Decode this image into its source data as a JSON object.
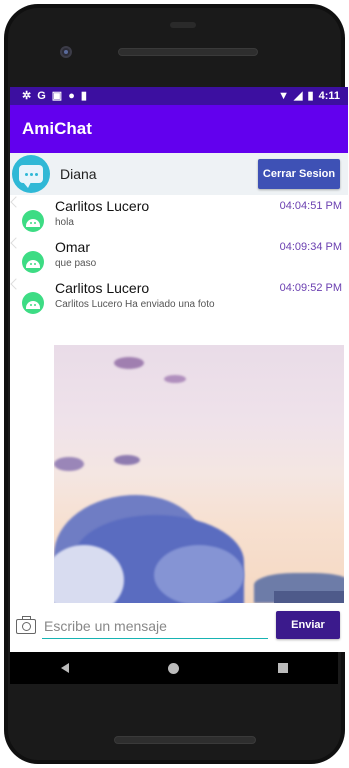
{
  "status_bar": {
    "left_icons": [
      "gear-icon",
      "google-icon",
      "gallery-icon",
      "dot-icon",
      "sd-card-icon"
    ],
    "time": "4:11"
  },
  "app_bar": {
    "title": "AmiChat"
  },
  "user_bar": {
    "name": "Diana",
    "logout_label": "Cerrar Sesion"
  },
  "messages": [
    {
      "sender": "Carlitos Lucero",
      "time": "04:04:51 PM",
      "text": "hola"
    },
    {
      "sender": "Omar",
      "time": "04:09:34 PM",
      "text": "que paso"
    },
    {
      "sender": "Carlitos Lucero",
      "time": "04:09:52 PM",
      "text": "Carlitos Lucero Ha enviado una foto"
    }
  ],
  "composer": {
    "placeholder": "Escribe un mensaje",
    "send_label": "Enviar"
  },
  "colors": {
    "primary": "#6200ee",
    "status_bar": "#3c0fa0",
    "logout_button": "#3e51b5",
    "send_button": "#3b1a8c",
    "time_text": "#6a3fb0",
    "avatar": "#3ddc84"
  }
}
